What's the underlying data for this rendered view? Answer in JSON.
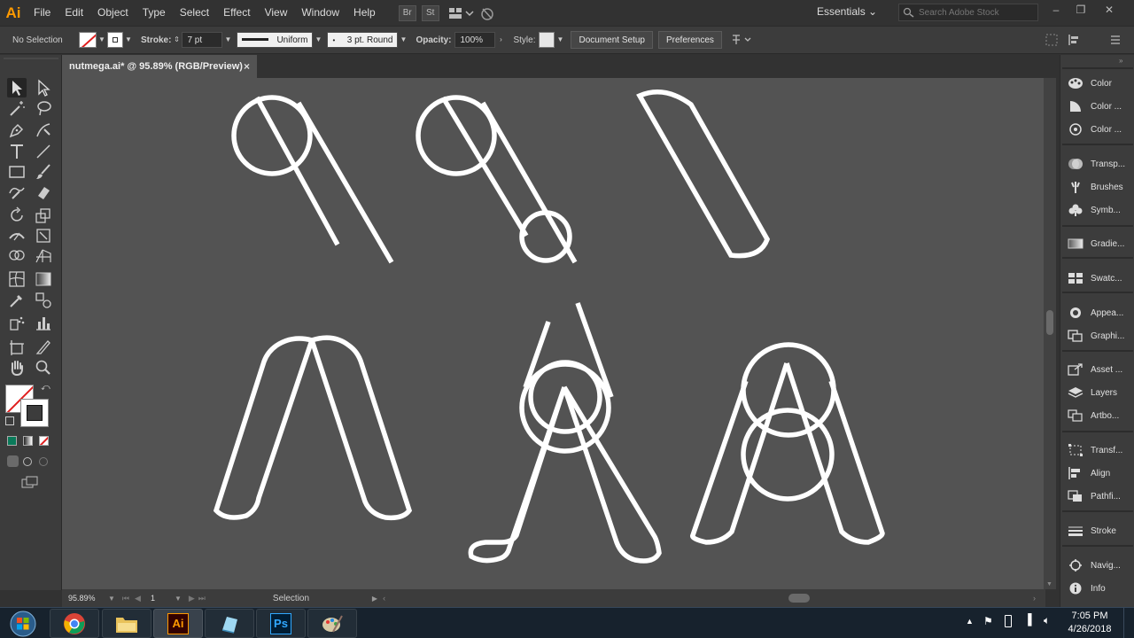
{
  "app": {
    "logo_text": "Ai"
  },
  "menubar": {
    "items": [
      "File",
      "Edit",
      "Object",
      "Type",
      "Select",
      "Effect",
      "View",
      "Window",
      "Help"
    ],
    "bridge_label": "Br",
    "stock_label": "St",
    "workspace": "Essentials",
    "search_placeholder": "Search Adobe Stock"
  },
  "controlbar": {
    "selection_status": "No Selection",
    "stroke_label": "Stroke:",
    "stroke_weight": "7 pt",
    "profile_label": "Uniform",
    "brush_label": "3 pt. Round",
    "opacity_label": "Opacity:",
    "opacity_value": "100%",
    "style_label": "Style:",
    "document_setup_label": "Document Setup",
    "preferences_label": "Preferences"
  },
  "document": {
    "tab_title": "nutmega.ai* @ 95.89% (RGB/Preview)",
    "close_glyph": "×"
  },
  "statusbar": {
    "zoom": "95.89%",
    "artboard_number": "1",
    "current_tool": "Selection"
  },
  "panels": [
    {
      "label": "Color",
      "icon": "color-icon"
    },
    {
      "label": "Color ...",
      "icon": "color-guide-icon"
    },
    {
      "label": "Color ...",
      "icon": "color-themes-icon"
    },
    {
      "label": "Transp...",
      "icon": "transparency-icon"
    },
    {
      "label": "Brushes",
      "icon": "brushes-icon"
    },
    {
      "label": "Symb...",
      "icon": "symbols-icon"
    },
    {
      "label": "Gradie...",
      "icon": "gradient-icon"
    },
    {
      "label": "Swatc...",
      "icon": "swatches-icon"
    },
    {
      "label": "Appea...",
      "icon": "appearance-icon"
    },
    {
      "label": "Graphi...",
      "icon": "graphic-styles-icon"
    },
    {
      "label": "Asset ...",
      "icon": "asset-export-icon"
    },
    {
      "label": "Layers",
      "icon": "layers-icon"
    },
    {
      "label": "Artbo...",
      "icon": "artboards-icon"
    },
    {
      "label": "Transf...",
      "icon": "transform-icon"
    },
    {
      "label": "Align",
      "icon": "align-icon"
    },
    {
      "label": "Pathfi...",
      "icon": "pathfinder-icon"
    },
    {
      "label": "Stroke",
      "icon": "stroke-icon"
    },
    {
      "label": "Navig...",
      "icon": "navigator-icon"
    },
    {
      "label": "Info",
      "icon": "info-icon"
    }
  ],
  "taskbar": {
    "illustrator_label": "Ai",
    "photoshop_label": "Ps",
    "time": "7:05 PM",
    "date": "4/26/2018"
  },
  "colors": {
    "canvas": "#535353",
    "artwork_stroke": "#ffffff",
    "ai_orange": "#ff9a00",
    "ps_blue": "#31a8ff"
  }
}
